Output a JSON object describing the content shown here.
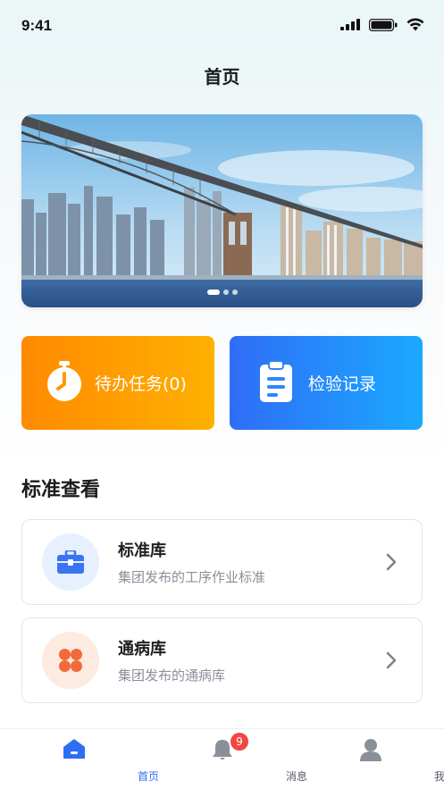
{
  "status_bar": {
    "time": "9:41"
  },
  "header": {
    "title": "首页"
  },
  "banner": {
    "slide_count": 3,
    "active_slide": 1
  },
  "actions": [
    {
      "label": "待办任务(0)",
      "icon": "stopwatch-icon",
      "color_from": "#ff8a00",
      "color_to": "#ffb000"
    },
    {
      "label": "检验记录",
      "icon": "clipboard-icon",
      "color_from": "#2f6df6",
      "color_to": "#1aa9ff"
    }
  ],
  "section": {
    "title": "标准查看"
  },
  "list": [
    {
      "title": "标准库",
      "subtitle": "集团发布的工序作业标准",
      "icon": "toolbox-icon",
      "accent": "#3b74f0"
    },
    {
      "title": "通病库",
      "subtitle": "集团发布的通病库",
      "icon": "clover-icon",
      "accent": "#f26a3a"
    }
  ],
  "tab_bar": {
    "tabs": [
      {
        "label": "首页",
        "icon": "home-icon",
        "active": true
      },
      {
        "label": "消息",
        "icon": "bell-icon",
        "badge": "9"
      },
      {
        "label": "我的",
        "icon": "user-icon"
      }
    ]
  }
}
